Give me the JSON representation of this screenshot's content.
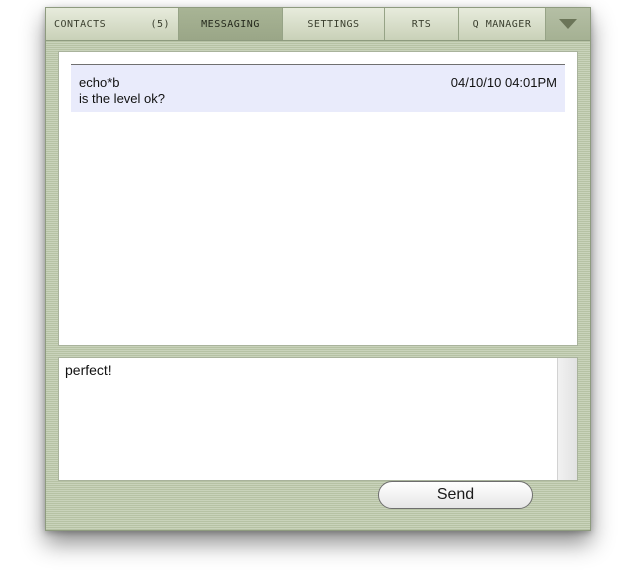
{
  "tabs": {
    "contacts": {
      "label": "CONTACTS",
      "count": "(5)"
    },
    "messaging": {
      "label": "MESSAGING"
    },
    "settings": {
      "label": "SETTINGS"
    },
    "rts": {
      "label": "RTS"
    },
    "qmanager": {
      "label": "Q MANAGER"
    },
    "active": "messaging",
    "menu_icon": "triangle-down-icon"
  },
  "messages": [
    {
      "sender": "echo*b",
      "timestamp": "04/10/10 04:01PM",
      "text": "is the level ok?"
    }
  ],
  "compose": {
    "value": "perfect!"
  },
  "send_button": {
    "label": "Send"
  },
  "colors": {
    "background": "#b6c2a4",
    "active_tab": "#9aa687",
    "message_highlight": "#e9ebfb"
  }
}
